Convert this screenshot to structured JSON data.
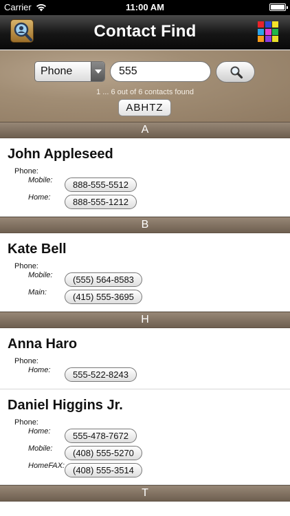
{
  "status": {
    "carrier": "Carrier",
    "time": "11:00 AM",
    "battery_level": 1.0
  },
  "nav": {
    "title": "Contact Find"
  },
  "search": {
    "field_select": "Phone",
    "query": "555",
    "found_text": "1 ... 6 out of 6 contacts found",
    "index_letters": "ABHTZ"
  },
  "list": {
    "sections": [
      {
        "letter": "A",
        "contacts": [
          {
            "name": "John Appleseed",
            "phone_label": "Phone:",
            "phones": [
              {
                "type": "Mobile:",
                "number": "888-555-5512"
              },
              {
                "type": "Home:",
                "number": "888-555-1212"
              }
            ]
          }
        ]
      },
      {
        "letter": "B",
        "contacts": [
          {
            "name": "Kate Bell",
            "phone_label": "Phone:",
            "phones": [
              {
                "type": "Mobile:",
                "number": "(555) 564-8583"
              },
              {
                "type": "Main:",
                "number": "(415) 555-3695"
              }
            ]
          }
        ]
      },
      {
        "letter": "H",
        "contacts": [
          {
            "name": "Anna Haro",
            "phone_label": "Phone:",
            "phones": [
              {
                "type": "Home:",
                "number": "555-522-8243"
              }
            ]
          },
          {
            "name": "Daniel Higgins Jr.",
            "phone_label": "Phone:",
            "phones": [
              {
                "type": "Home:",
                "number": "555-478-7672"
              },
              {
                "type": "Mobile:",
                "number": "(408) 555-5270"
              },
              {
                "type": "HomeFAX:",
                "number": "(408) 555-3514"
              }
            ]
          }
        ]
      },
      {
        "letter": "T",
        "contacts": []
      }
    ]
  },
  "colors": {
    "grid_icon": [
      "#e8232a",
      "#2f49d6",
      "#f4e22a",
      "#2fa4e8",
      "#e83ccf",
      "#1fb64a",
      "#f59c1b",
      "#8a3be0",
      "#e8e02a"
    ]
  }
}
